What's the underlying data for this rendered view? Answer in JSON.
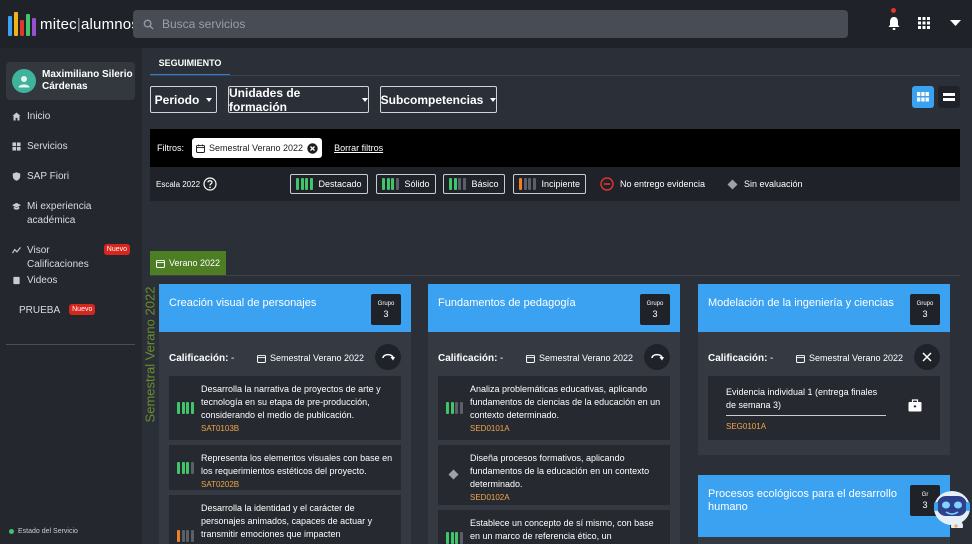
{
  "app": {
    "logo_prefix": "mitec",
    "logo_suffix": "alumnos",
    "search_placeholder": "Busca servicios"
  },
  "colors": {
    "accent": "#3ba2f2",
    "destacado": "#41c46a",
    "incipiente": "#f07f2a",
    "period": "#4d7e24"
  },
  "user": {
    "name": "Maximiliano Silerio Cárdenas"
  },
  "sidebar": {
    "items": [
      {
        "label": "Inicio",
        "icon": "home-icon"
      },
      {
        "label": "Servicios",
        "icon": "grid-icon"
      },
      {
        "label": "SAP Fiori",
        "icon": "shield-icon"
      },
      {
        "label": "Mi experiencia académica",
        "icon": "graduation-cap-icon"
      },
      {
        "label": "Visor Calificaciones",
        "icon": "chart-line-icon",
        "badge": "Nuevo"
      },
      {
        "label": "Videos",
        "icon": "video-icon"
      },
      {
        "label": "PRUEBA",
        "badge": "Nuevo"
      }
    ],
    "service_status": "Estado del Servicio"
  },
  "main": {
    "tab": "SEGUIMIENTO",
    "dropdowns": [
      "Periodo",
      "Unidades de formación",
      "Subcompetencias"
    ],
    "filters": {
      "label": "Filtros:",
      "chip": "Semestral Verano 2022",
      "clear": "Borrar filtros"
    },
    "legend": {
      "scale": "Escala 2022",
      "levels": [
        "Destacado",
        "Sólido",
        "Básico",
        "Incipiente"
      ],
      "no_evidence": "No entrego evidencia",
      "no_evaluation": "Sin evaluación"
    },
    "period_tab": "Verano 2022",
    "vertical_label": "Semestral Verano 2022"
  },
  "cards": [
    {
      "title": "Creación visual de personajes",
      "group_label": "Grupo",
      "group_number": "3",
      "grade_label": "Calificación:",
      "grade_value": "-",
      "semester": "Semestral Verano 2022",
      "evidences": [
        {
          "text": "Desarrolla la narrativa de proyectos de arte y tecnología en su etapa de pre-producción, considerando el medio de publicación.",
          "code": "SAT0103B",
          "level": "destacado"
        },
        {
          "text": "Representa los elementos visuales con base en los requerimientos estéticos del proyecto.",
          "code": "SAT0202B",
          "level": "solido"
        },
        {
          "text": "Desarrolla la identidad y el carácter de personajes animados, capaces de actuar y transmitir emociones que impacten",
          "code": "",
          "level": "incipiente"
        }
      ]
    },
    {
      "title": "Fundamentos de pedagogía",
      "group_label": "Grupo",
      "group_number": "3",
      "grade_label": "Calificación:",
      "grade_value": "-",
      "semester": "Semestral Verano 2022",
      "evidences": [
        {
          "text": "Analiza problemáticas educativas, aplicando fundamentos de ciencias de la educación en un contexto determinado.",
          "code": "SED0101A",
          "level": "basico"
        },
        {
          "text": "Diseña procesos formativos, aplicando fundamentos de la educación en un contexto determinado.",
          "code": "SED0102A",
          "level": "sin-evaluacion"
        },
        {
          "text": "Establece un concepto de sí mismo, con base en un marco de referencia ético, un",
          "code": "",
          "level": "solido"
        }
      ]
    },
    {
      "title": "Modelación de la ingeniería y ciencias",
      "group_label": "Grupo",
      "group_number": "3",
      "grade_label": "Calificación:",
      "grade_value": "-",
      "semester": "Semestral Verano 2022",
      "evidences": [
        {
          "text": "Evidencia individual 1 (entrega finales de semana 3)",
          "code": "SEG0101A"
        }
      ]
    },
    {
      "title": "Procesos ecológicos para el desarrollo humano",
      "group_label": "Gr",
      "group_number": "3"
    }
  ]
}
